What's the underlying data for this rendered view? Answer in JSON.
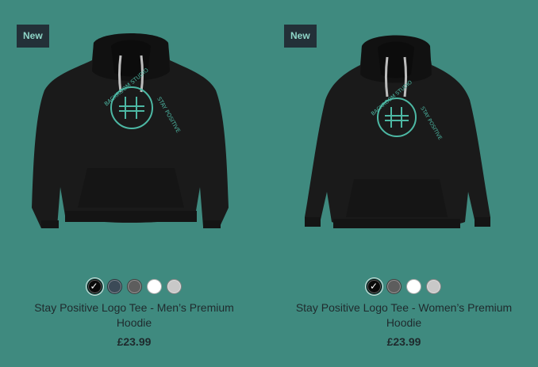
{
  "products": [
    {
      "badge": "New",
      "title": "Stay Positive Logo Tee - Men’s Premium Hoodie",
      "price": "£23.99",
      "image_icon": "mens-hoodie-icon",
      "colors": [
        {
          "hex": "#0a0a0a",
          "selected": true
        },
        {
          "hex": "#3b4a57",
          "selected": false
        },
        {
          "hex": "#5d5d5d",
          "selected": false
        },
        {
          "hex": "#ffffff",
          "selected": false
        },
        {
          "hex": "#c8c8c8",
          "selected": false
        }
      ]
    },
    {
      "badge": "New",
      "title": "Stay Positive Logo Tee - Women’s Premium Hoodie",
      "price": "£23.99",
      "image_icon": "womens-hoodie-icon",
      "colors": [
        {
          "hex": "#0a0a0a",
          "selected": true
        },
        {
          "hex": "#5d5d5d",
          "selected": false
        },
        {
          "hex": "#ffffff",
          "selected": false
        },
        {
          "hex": "#c8c8c8",
          "selected": false
        }
      ]
    }
  ],
  "logo_text": {
    "top": "BACKROOM STUDIO",
    "right": "STAY POSITIVE"
  },
  "colors": {
    "background": "#3f8a7f",
    "badge_bg": "#233038",
    "badge_text": "#8fd6c8",
    "logo": "#4db8a4"
  }
}
